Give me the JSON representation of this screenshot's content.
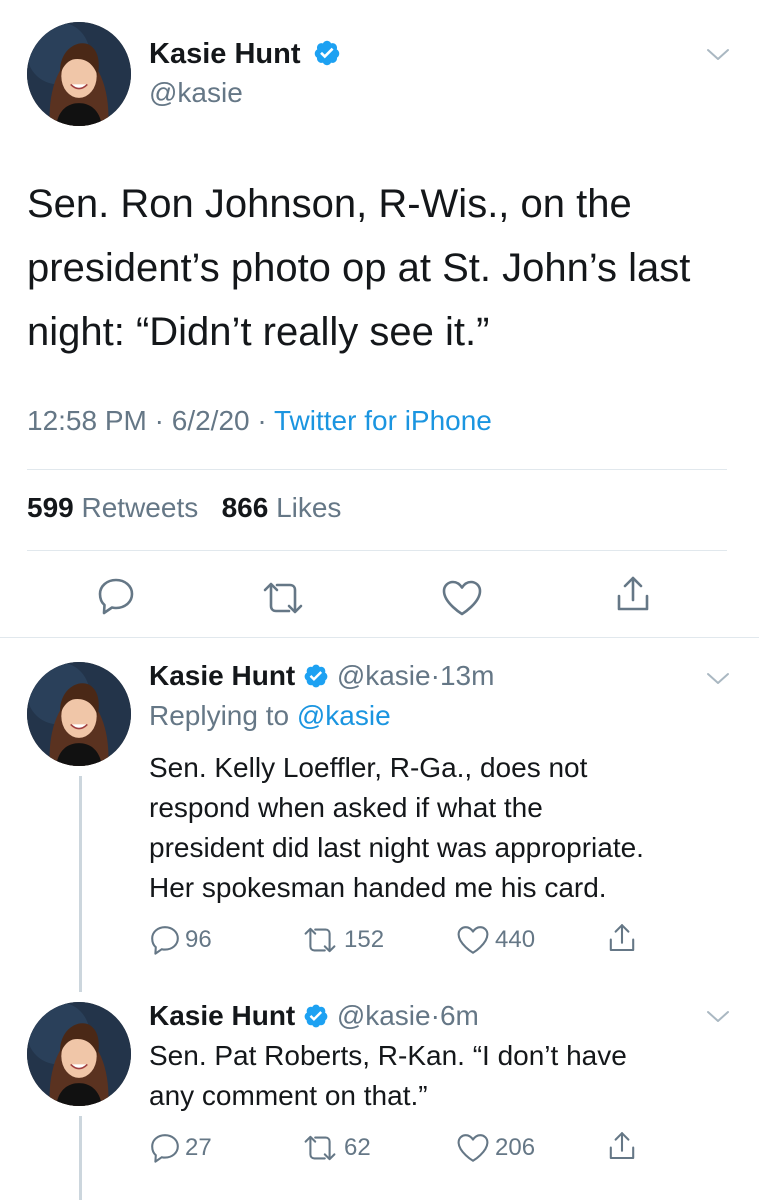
{
  "main_tweet": {
    "author_name": "Kasie Hunt",
    "author_handle": "@kasie",
    "text_line1": "Sen. Ron Johnson, R-Wis., on the",
    "text_line2": "president’s photo op at St. John’s last",
    "text_line3": "night: “Didn’t really see it.”",
    "time": "12:58 PM",
    "date": "6/2/20",
    "separator": "·",
    "source": "Twitter for iPhone",
    "retweets_count": "599",
    "retweets_label": "Retweets",
    "likes_count": "866",
    "likes_label": "Likes"
  },
  "replies": [
    {
      "author_name": "Kasie Hunt",
      "author_handle": "@kasie",
      "separator": "·",
      "time_ago": "13m",
      "replying_prefix": "Replying to",
      "replying_to": "@kasie",
      "text_line1": "Sen. Kelly Loeffler, R-Ga., does not",
      "text_line2": "respond when asked if what the",
      "text_line3": "president did last night was appropriate.",
      "text_line4": "Her spokesman handed me his card.",
      "reply_count": "96",
      "retweet_count": "152",
      "like_count": "440"
    },
    {
      "author_name": "Kasie Hunt",
      "author_handle": "@kasie",
      "separator": "·",
      "time_ago": "6m",
      "text_line1": "Sen. Pat Roberts, R-Kan. “I don’t have",
      "text_line2": "any comment on that.”",
      "reply_count": "27",
      "retweet_count": "62",
      "like_count": "206"
    }
  ],
  "icons": {
    "verified": "verified-badge-icon",
    "chevron": "chevron-down-icon",
    "reply": "reply-icon",
    "retweet": "retweet-icon",
    "like": "heart-icon",
    "share": "share-icon"
  },
  "colors": {
    "accent": "#1b95e0",
    "verified": "#1da1f2",
    "secondary_text": "#657786",
    "divider": "#e1e8ed"
  }
}
